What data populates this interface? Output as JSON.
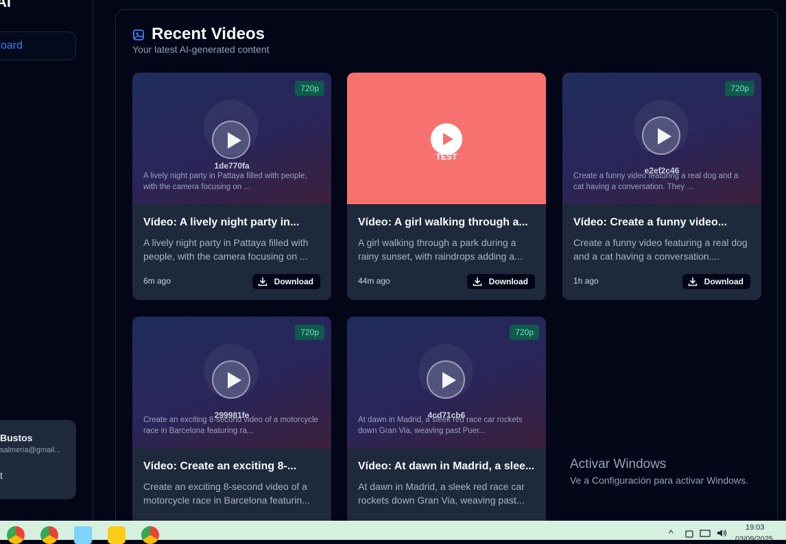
{
  "sidebar": {
    "brand": "AI",
    "active_nav": "oard",
    "user": {
      "name": "Bustos",
      "email": "salmeria@gmail...",
      "logout": "t"
    }
  },
  "panel": {
    "title": "Recent Videos",
    "subtitle": "Your latest AI-generated content"
  },
  "videos": [
    {
      "resolution": "720p",
      "id": "1de770fa",
      "thumb_desc": "A lively night party in Pattaya filled with people, with the camera focusing on ...",
      "title": "Vídeo: A lively night party in...",
      "desc": "A lively night party in Pattaya filled with people, with the camera focusing on ...",
      "time": "6m ago",
      "download": "Download"
    },
    {
      "label": "TEST",
      "title": "Vídeo: A girl walking through a...",
      "desc": "A girl walking through a park during a rainy sunset, with raindrops adding a...",
      "time": "44m ago",
      "download": "Download"
    },
    {
      "resolution": "720p",
      "id": "e2ef2c46",
      "thumb_desc": "Create a funny video featuring a real dog and a cat having a conversation. They ...",
      "title": "Vídeo: Create a funny video...",
      "desc": "Create a funny video featuring a real dog and a cat having a conversation....",
      "time": "1h ago",
      "download": "Download"
    },
    {
      "resolution": "720p",
      "id": "299981fe",
      "thumb_desc": "Create an exciting 8-second video of a motorcycle race in Barcelona featuring ra...",
      "title": "Vídeo: Create an exciting 8-...",
      "desc": "Create an exciting 8-second video of a motorcycle race in Barcelona featurin...",
      "time": "",
      "download": ""
    },
    {
      "resolution": "720p",
      "id": "4cd71cb6",
      "thumb_desc": "At dawn in Madrid, a sleek red race car rockets down Gran Via, weaving past Puer...",
      "title": "Vídeo: At dawn in Madrid, a slee...",
      "desc": "At dawn in Madrid, a sleek red race car rockets down Gran Via, weaving past...",
      "time": "",
      "download": ""
    }
  ],
  "watermark": {
    "title": "Activar Windows",
    "subtitle": "Ve a Configuración para activar Windows."
  },
  "taskbar": {
    "time": "19:03",
    "date": "03/09/2025",
    "tray_chevron": "^"
  },
  "colors": {
    "background": "#020617",
    "card": "#1e293b",
    "accent": "#3b82f6",
    "badge": "#10594d",
    "test_thumb": "#f87171"
  }
}
